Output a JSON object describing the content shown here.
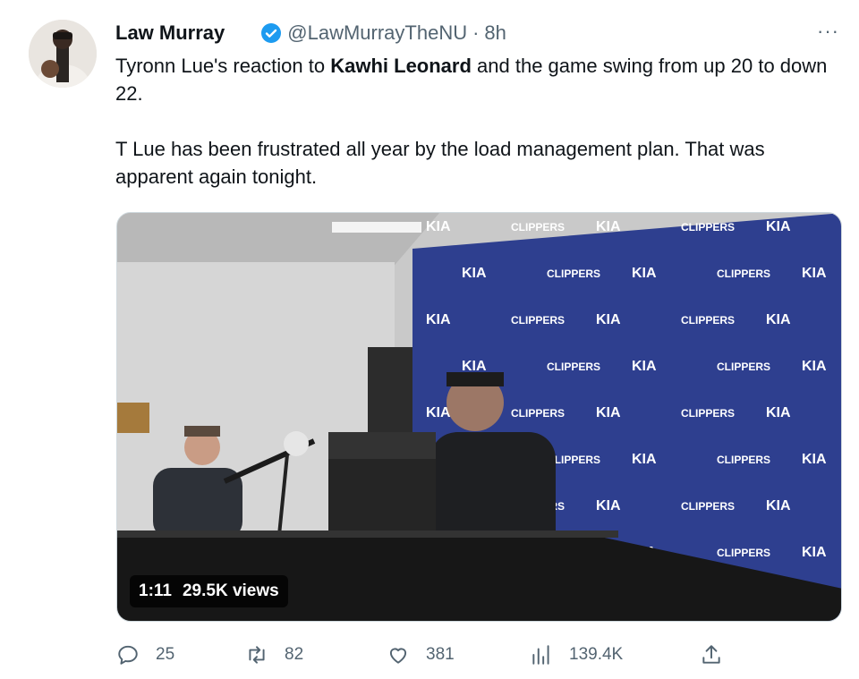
{
  "tweet": {
    "author_name": "Law Murray",
    "handle": "@LawMurrayTheNU",
    "separator": "·",
    "time": "8h",
    "more": "···",
    "text_part1": "Tyronn Lue's reaction to ",
    "text_bold": "Kawhi Leonard",
    "text_part2": " and the game swing from up 20 to down 22.",
    "text_para2": "T Lue has been frustrated all year by the load management plan. That was apparent again tonight."
  },
  "video": {
    "duration": "1:11",
    "views": "29.5K views",
    "backdrop_brands": [
      "KIA",
      "CLIPPERS"
    ]
  },
  "actions": {
    "replies": "25",
    "retweets": "82",
    "likes": "381",
    "views": "139.4K"
  },
  "colors": {
    "verified": "#1d9bf0",
    "secondary_text": "#536471",
    "backdrop_blue": "#2e3f8f"
  }
}
